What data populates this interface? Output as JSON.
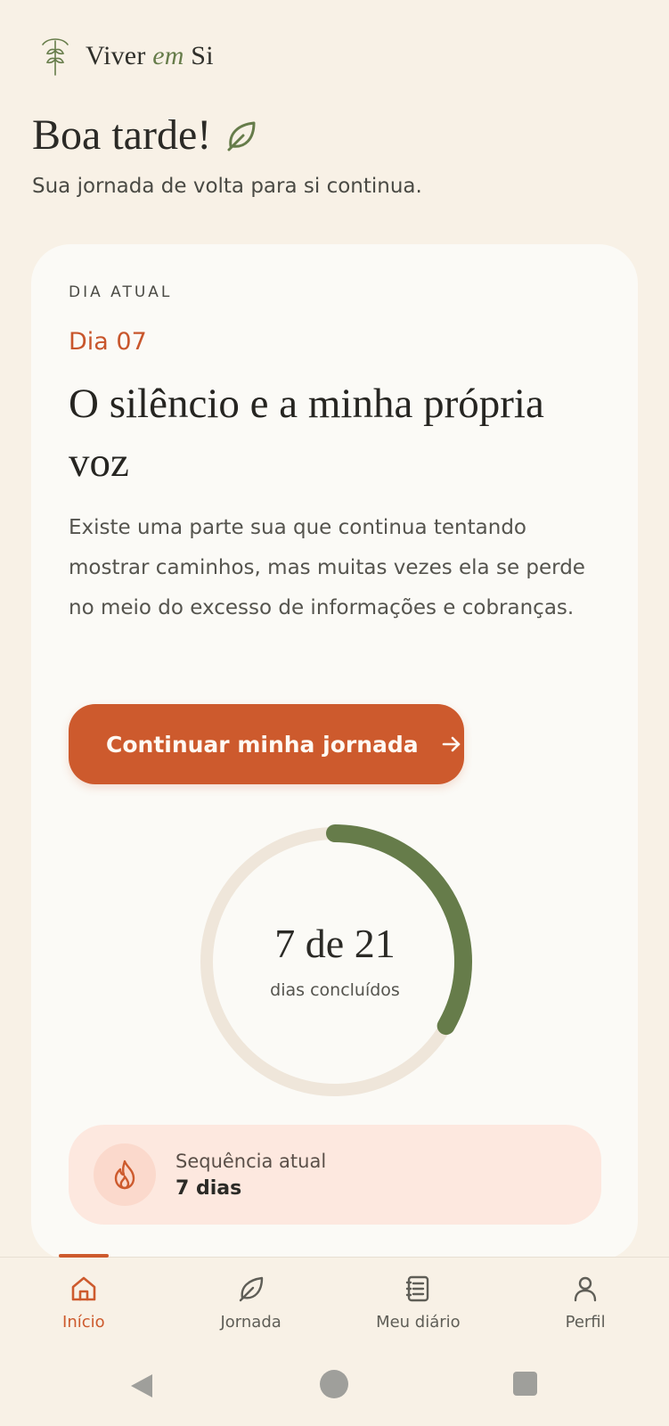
{
  "header": {
    "brand_part1": "Viver ",
    "brand_part2": "em",
    "brand_part3": " Si",
    "logo_icon": "tree-icon"
  },
  "greeting": {
    "title": "Boa tarde!",
    "icon": "leaf-icon",
    "subtitle": "Sua jornada de volta para si continua."
  },
  "card": {
    "eyebrow": "DIA ATUAL",
    "day_label": "Dia 07",
    "title": "O silêncio e a minha própria voz",
    "description": "Existe uma parte sua que continua tentando mostrar caminhos, mas muitas vezes ela se perde no meio do excesso de informações e cobranças.",
    "cta_label": "Continuar minha jornada",
    "cta_icon": "arrow-right-icon"
  },
  "progress": {
    "completed": 7,
    "total": 21,
    "count_text": "7 de 21",
    "caption": "dias concluídos"
  },
  "streak": {
    "icon": "flame-icon",
    "label": "Sequência atual",
    "value": "7 dias"
  },
  "nav": {
    "items": [
      {
        "label": "Início",
        "icon": "home-icon",
        "active": true
      },
      {
        "label": "Jornada",
        "icon": "leaf-icon",
        "active": false
      },
      {
        "label": "Meu diário",
        "icon": "journal-icon",
        "active": false
      },
      {
        "label": "Perfil",
        "icon": "user-icon",
        "active": false
      }
    ]
  },
  "colors": {
    "background": "#f8f1e6",
    "card": "#fbfaf6",
    "accent": "#cd5a2d",
    "green": "#667c4a",
    "ring_track": "#efe6da",
    "streak_bg": "#fde8df"
  }
}
